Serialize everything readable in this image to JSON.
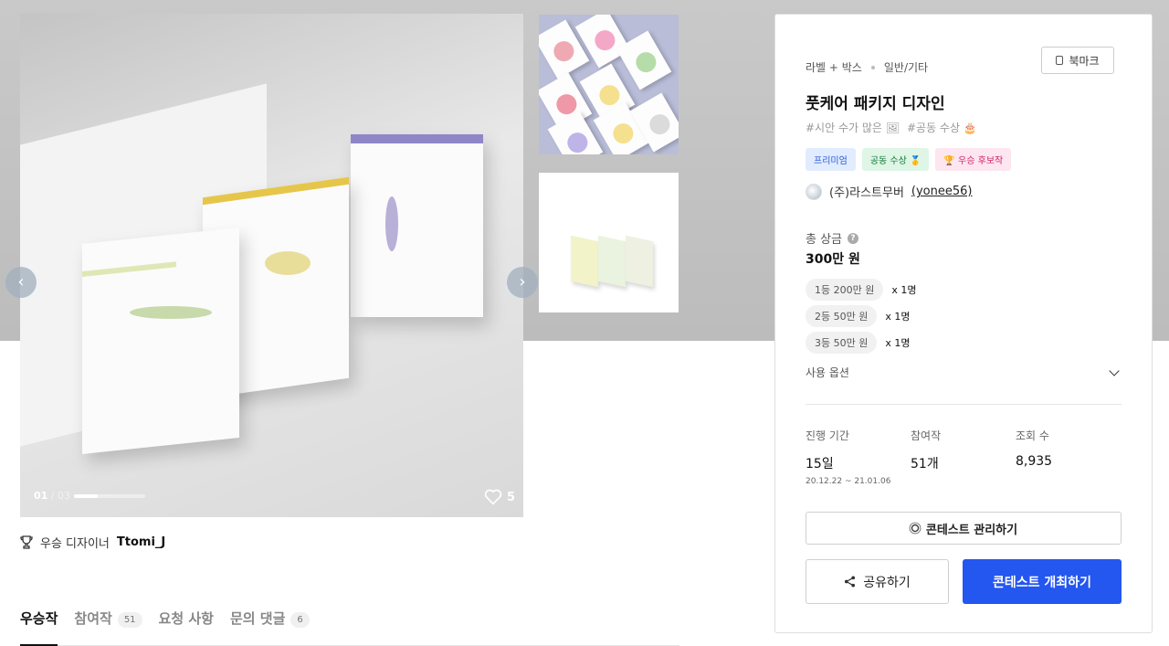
{
  "gallery": {
    "counter_current": "01",
    "counter_separator": " / ",
    "counter_total": "03",
    "progress": 0.33,
    "likes": "5",
    "prev_icon": "chevron-left-icon",
    "next_icon": "chevron-right-icon"
  },
  "designer": {
    "label": "우승 디자이너",
    "name": "Ttomi_J",
    "icon": "trophy-icon"
  },
  "tabs": [
    {
      "label": "우승작",
      "count": ""
    },
    {
      "label": "참여작",
      "count": "51"
    },
    {
      "label": "요청 사항",
      "count": ""
    },
    {
      "label": "문의 댓글",
      "count": "6"
    }
  ],
  "panel": {
    "category": "라벨 + 박스",
    "subcategory": "일반/기타",
    "bookmark_label": "북마크",
    "title": "풋케어 패키지 디자인",
    "hashtags": [
      "#시안 수가 많은 🖼",
      "#공동 수상 🎂"
    ],
    "badges": {
      "premium": "프리미엄",
      "joint": "공동 수상 🥇",
      "candidate": "🏆 우승 후보작"
    },
    "host_name": "(주)라스트무버",
    "host_user": "(yonee56)",
    "prize_label": "총 상금",
    "prize_total": "300만 원",
    "prizes": [
      {
        "rank": "1등 200만 원",
        "count": "x 1명"
      },
      {
        "rank": "2등 50만 원",
        "count": "x 1명"
      },
      {
        "rank": "3등 50만 원",
        "count": "x 1명"
      }
    ],
    "usage_options": "사용 옵션",
    "stats": {
      "period_label": "진행 기간",
      "period_value": "15일",
      "period_range": "20.12.22 ~ 21.01.06",
      "participants_label": "참여작",
      "participants_value": "51개",
      "views_label": "조회 수",
      "views_value": "8,935"
    },
    "manage_button": "콘테스트 관리하기",
    "share_button": "공유하기",
    "host_button": "콘테스트 개최하기"
  },
  "colors": {
    "primary": "#2456f0",
    "hero_bg": "#c4c4c4"
  }
}
